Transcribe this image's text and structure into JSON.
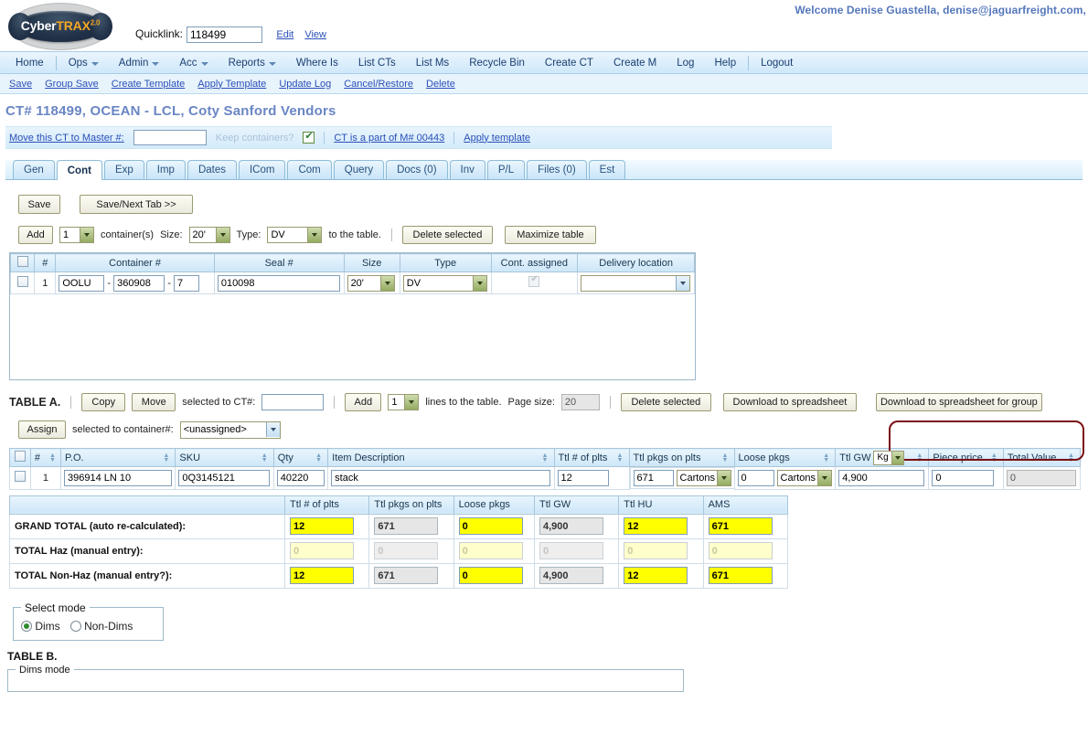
{
  "header": {
    "logo": {
      "part1": "Cyber",
      "part2": "TRAX",
      "version": "2.0"
    },
    "quicklink_label": "Quicklink:",
    "quicklink_value": "118499",
    "edit_link": "Edit",
    "view_link": "View",
    "welcome": "Welcome Denise Guastella, denise@jaguarfreight.com,"
  },
  "mainnav": [
    {
      "label": "Home",
      "caret": false
    },
    {
      "label": "Ops",
      "caret": true
    },
    {
      "label": "Admin",
      "caret": true
    },
    {
      "label": "Acc",
      "caret": true
    },
    {
      "label": "Reports",
      "caret": true
    },
    {
      "label": "Where Is",
      "caret": false
    },
    {
      "label": "List CTs",
      "caret": false
    },
    {
      "label": "List Ms",
      "caret": false
    },
    {
      "label": "Recycle Bin",
      "caret": false
    },
    {
      "label": "Create CT",
      "caret": false
    },
    {
      "label": "Create M",
      "caret": false
    },
    {
      "label": "Log",
      "caret": false
    },
    {
      "label": "Help",
      "caret": false
    },
    {
      "label": "Logout",
      "caret": false
    }
  ],
  "subnav": [
    {
      "label": "Save"
    },
    {
      "label": "Group Save"
    },
    {
      "label": "Create Template"
    },
    {
      "label": "Apply Template"
    },
    {
      "label": "Update Log"
    },
    {
      "label": "Cancel/Restore"
    },
    {
      "label": "Delete"
    }
  ],
  "page_title": "CT# 118499, OCEAN - LCL, Coty Sanford Vendors",
  "masterbar": {
    "move_link": "Move this CT to Master #:",
    "master_value": "",
    "keep_containers_label": "Keep containers?",
    "keep_containers_checked": true,
    "part_of_link": "CT is a part of M# 00443",
    "apply_template_link": "Apply template"
  },
  "tabs": [
    {
      "label": "Gen",
      "active": false
    },
    {
      "label": "Cont",
      "active": true
    },
    {
      "label": "Exp",
      "active": false
    },
    {
      "label": "Imp",
      "active": false
    },
    {
      "label": "Dates",
      "active": false
    },
    {
      "label": "ICom",
      "active": false
    },
    {
      "label": "Com",
      "active": false
    },
    {
      "label": "Query",
      "active": false
    },
    {
      "label": "Docs (0)",
      "active": false
    },
    {
      "label": "Inv",
      "active": false
    },
    {
      "label": "P/L",
      "active": false
    },
    {
      "label": "Files (0)",
      "active": false
    },
    {
      "label": "Est",
      "active": false
    }
  ],
  "save_toolbar": {
    "save_label": "Save",
    "save_next_label": "Save/Next Tab >>"
  },
  "container_toolbar": {
    "add_label": "Add",
    "count_value": "1",
    "containers_text": "container(s)",
    "size_label": "Size:",
    "size_value": "20'",
    "type_label": "Type:",
    "type_value": "DV",
    "to_table_text": "to the table.",
    "delete_selected_label": "Delete selected",
    "maximize_label": "Maximize table"
  },
  "container_table": {
    "columns": [
      "#",
      "Container #",
      "Seal #",
      "Size",
      "Type",
      "Cont. assigned",
      "Delivery location"
    ],
    "rows": [
      {
        "num": "1",
        "container_prefix": "OOLU",
        "container_mid": "360908",
        "container_suffix": "7",
        "seal": "010098",
        "size": "20'",
        "type": "DV",
        "assigned": true,
        "delivery_location": ""
      }
    ]
  },
  "table_a": {
    "title": "TABLE A.",
    "copy_label": "Copy",
    "move_label": "Move",
    "selected_to_ct_text": "selected to CT#:",
    "ct_value": "",
    "add_label": "Add",
    "lines_value": "1",
    "lines_text": "lines to the table.",
    "page_size_label": "Page size:",
    "page_size_value": "20",
    "delete_selected_label": "Delete selected",
    "download_label": "Download to spreadsheet",
    "download_group_label": "Download to spreadsheet for group",
    "assign_label": "Assign",
    "assign_text": "selected to container#:",
    "assign_value": "<unassigned>",
    "highlight_color": "#7b0f14"
  },
  "items_table": {
    "columns": [
      "#",
      "P.O.",
      "SKU",
      "Qty",
      "Item Description",
      "Ttl # of plts",
      "Ttl pkgs on plts",
      "Loose pkgs",
      "Ttl GW",
      "Piece price",
      "Total Value"
    ],
    "gw_unit": "Kg",
    "rows": [
      {
        "num": "1",
        "po": "396914 LN 10",
        "sku": "0Q3145121",
        "qty": "40220",
        "description": "stack",
        "ttl_plts": "12",
        "ttl_pkgs": "671",
        "ttl_pkgs_unit": "Cartons",
        "loose_pkgs": "0",
        "loose_pkgs_unit": "Cartons",
        "ttl_gw": "4,900",
        "piece_price": "0",
        "total_value": "0"
      }
    ]
  },
  "totals_table": {
    "columns": [
      "Ttl # of plts",
      "Ttl pkgs on plts",
      "Loose pkgs",
      "Ttl GW",
      "Ttl HU",
      "AMS"
    ],
    "rows": [
      {
        "label": "GRAND TOTAL (auto re-calculated):",
        "cells": [
          {
            "value": "12",
            "style": "yellow"
          },
          {
            "value": "671",
            "style": "grey"
          },
          {
            "value": "0",
            "style": "yellow"
          },
          {
            "value": "4,900",
            "style": "grey"
          },
          {
            "value": "12",
            "style": "yellow"
          },
          {
            "value": "671",
            "style": "yellow"
          }
        ]
      },
      {
        "label": "TOTAL Haz (manual entry):",
        "cells": [
          {
            "value": "0",
            "style": "ylight"
          },
          {
            "value": "0",
            "style": "glight"
          },
          {
            "value": "0",
            "style": "ylight"
          },
          {
            "value": "0",
            "style": "glight"
          },
          {
            "value": "0",
            "style": "ylight"
          },
          {
            "value": "0",
            "style": "ylight"
          }
        ]
      },
      {
        "label": "TOTAL Non-Haz (manual entry?):",
        "cells": [
          {
            "value": "12",
            "style": "yellow"
          },
          {
            "value": "671",
            "style": "grey"
          },
          {
            "value": "0",
            "style": "yellow"
          },
          {
            "value": "4,900",
            "style": "grey"
          },
          {
            "value": "12",
            "style": "yellow"
          },
          {
            "value": "671",
            "style": "yellow"
          }
        ]
      }
    ]
  },
  "select_mode": {
    "legend": "Select mode",
    "options": [
      {
        "label": "Dims",
        "selected": true
      },
      {
        "label": "Non-Dims",
        "selected": false
      }
    ]
  },
  "table_b": {
    "title": "TABLE B.",
    "dims_legend": "Dims mode"
  }
}
